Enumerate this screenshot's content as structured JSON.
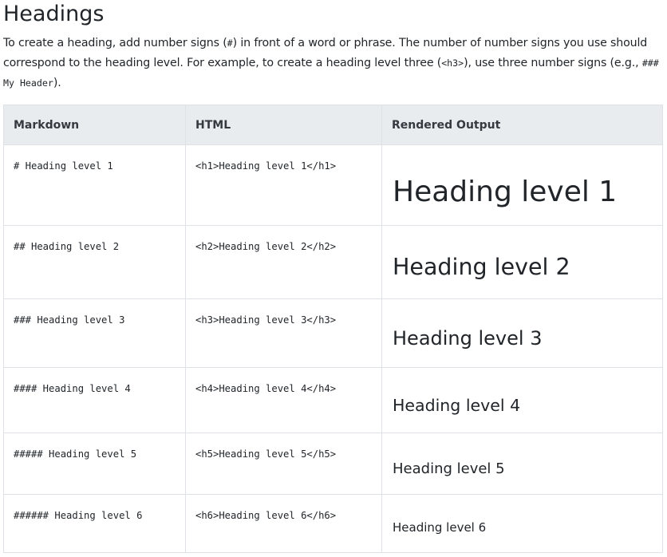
{
  "page": {
    "title": "Headings",
    "intro": {
      "part1": "To create a heading, add number signs (",
      "code1": "#",
      "part2": ") in front of a word or phrase. The number of number signs you use should correspond to the heading level. For example, to create a heading level three (",
      "code2": "<h3>",
      "part3": "), use three number signs (e.g., ",
      "code3": "### My Header",
      "part4": ")."
    }
  },
  "table": {
    "headers": [
      "Markdown",
      "HTML",
      "Rendered Output"
    ],
    "rows": [
      {
        "markdown": "# Heading level 1",
        "html": "<h1>Heading level 1</h1>",
        "rendered": "Heading level 1"
      },
      {
        "markdown": "## Heading level 2",
        "html": "<h2>Heading level 2</h2>",
        "rendered": "Heading level 2"
      },
      {
        "markdown": "### Heading level 3",
        "html": "<h3>Heading level 3</h3>",
        "rendered": "Heading level 3"
      },
      {
        "markdown": "#### Heading level 4",
        "html": "<h4>Heading level 4</h4>",
        "rendered": "Heading level 4"
      },
      {
        "markdown": "##### Heading level 5",
        "html": "<h5>Heading level 5</h5>",
        "rendered": "Heading level 5"
      },
      {
        "markdown": "###### Heading level 6",
        "html": "<h6>Heading level 6</h6>",
        "rendered": "Heading level 6"
      }
    ]
  }
}
